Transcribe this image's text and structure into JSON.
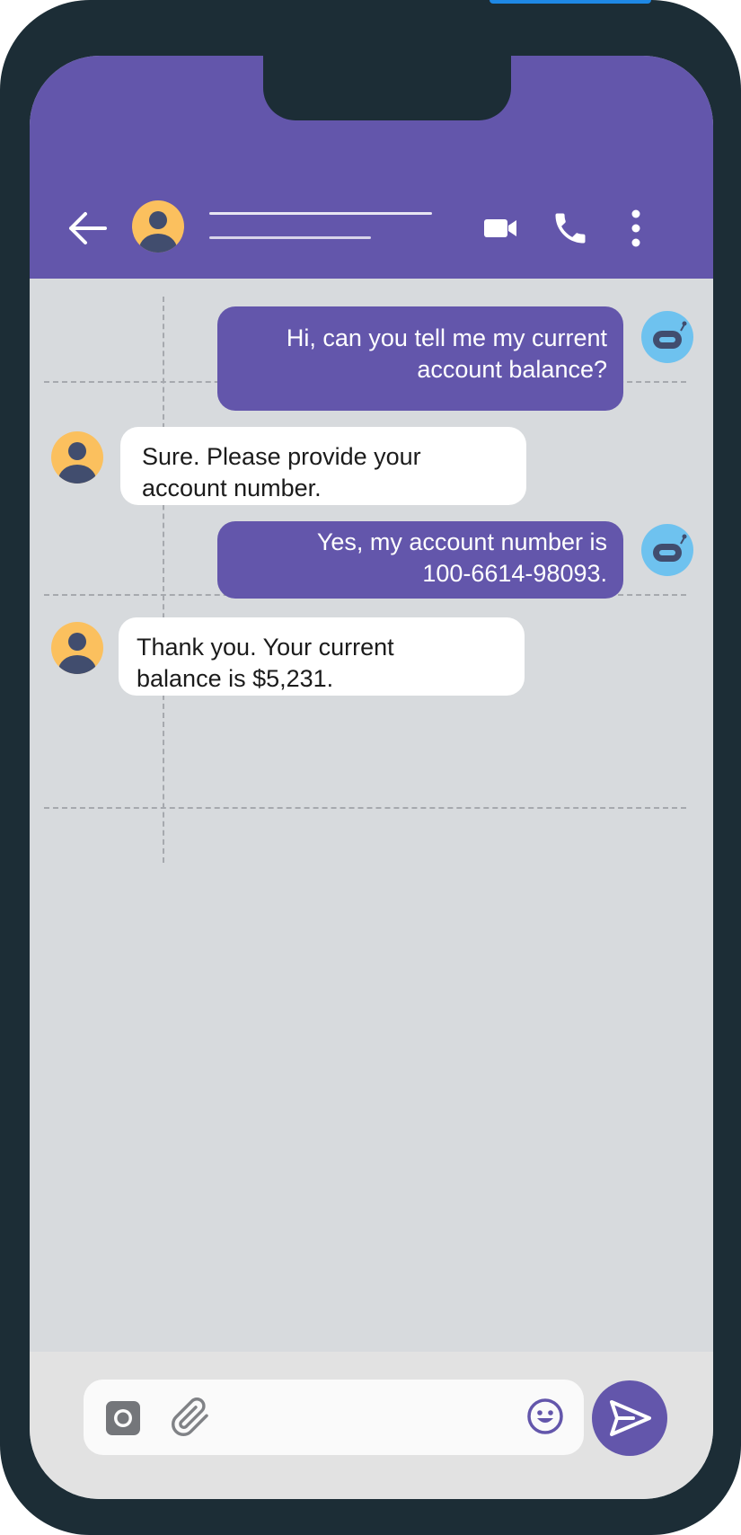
{
  "theme": {
    "header_color": "#6356ab",
    "frame_color": "#1c2d36",
    "chat_background": "#d7dadd",
    "incoming_bubble": "#ffffff",
    "outgoing_bubble": "#6356ab",
    "avatar_color": "#fbc05e",
    "bot_avatar_color": "#6ec2ef"
  },
  "header": {
    "back_icon": "arrow-left-icon",
    "avatar_icon": "user-avatar-icon",
    "actions": [
      {
        "name": "video-call",
        "icon": "video-camera-icon"
      },
      {
        "name": "voice-call",
        "icon": "phone-icon"
      },
      {
        "name": "more-options",
        "icon": "vertical-dots-icon"
      }
    ]
  },
  "messages": [
    {
      "direction": "outgoing",
      "avatar_icon": "robot-icon",
      "lines": [
        "Hi, can you tell me my current",
        "account balance?"
      ]
    },
    {
      "direction": "incoming",
      "avatar_icon": "user-avatar-icon",
      "lines": [
        "Sure. Please provide your",
        "account number."
      ]
    },
    {
      "direction": "outgoing",
      "avatar_icon": "robot-icon",
      "lines": [
        "Yes, my account number is",
        "100-6614-98093."
      ]
    },
    {
      "direction": "incoming",
      "avatar_icon": "user-avatar-icon",
      "lines": [
        "Thank you. Your current",
        "balance is $5,231."
      ]
    }
  ],
  "composer": {
    "camera_icon": "camera-icon",
    "attach_icon": "paperclip-icon",
    "emoji_icon": "smiley-icon",
    "send_icon": "send-arrow-icon"
  }
}
